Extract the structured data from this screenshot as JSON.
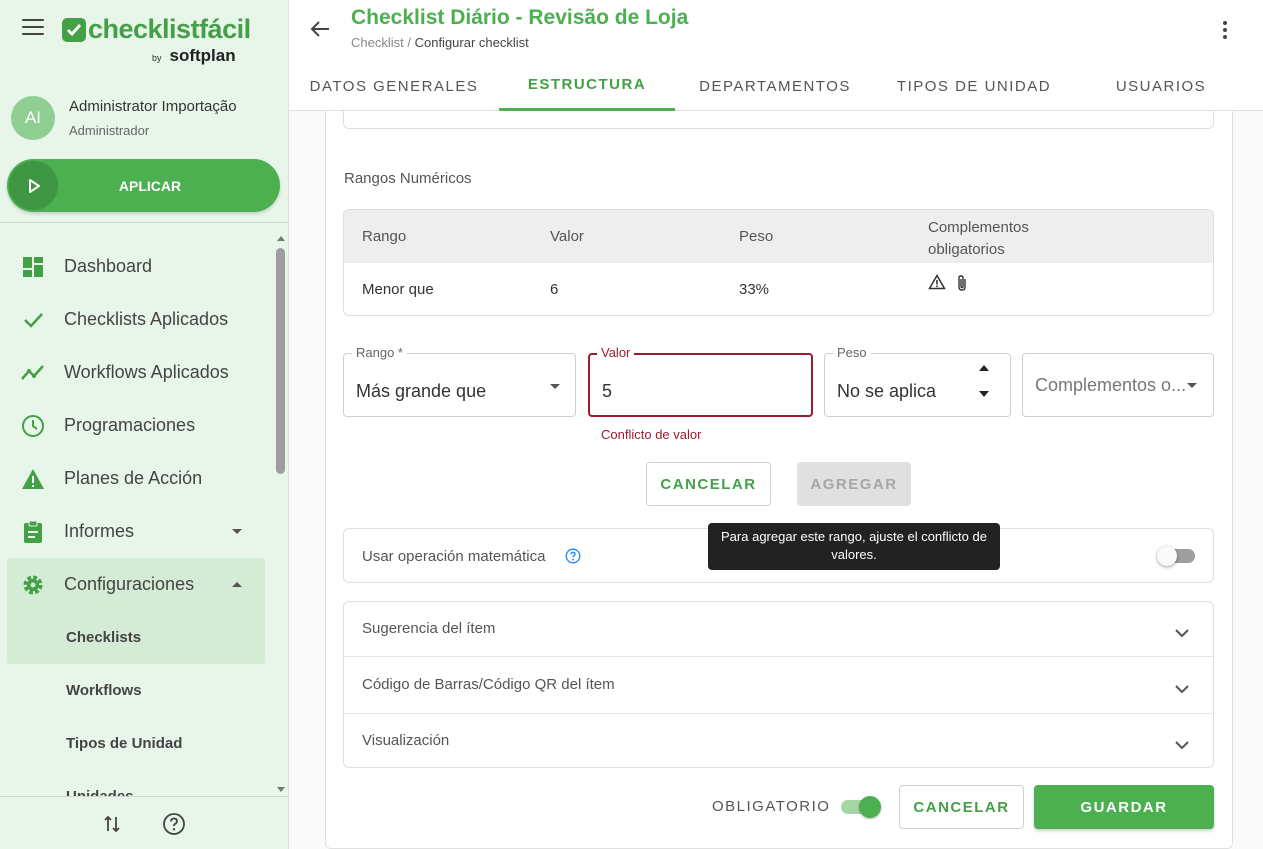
{
  "colors": {
    "brand": "#4caf50",
    "brand_dark": "#43a047",
    "sidebar_bg": "#e8f5e9",
    "error": "#9b1b30",
    "tooltip_bg": "#222222"
  },
  "brand": {
    "name": "checklistfácil",
    "by": "by",
    "company": "softplan"
  },
  "user": {
    "initials": "AI",
    "name": "Administrator Importação",
    "role": "Administrador"
  },
  "apply_button": {
    "label": "APLICAR",
    "icon": "play-icon"
  },
  "nav": {
    "items": [
      {
        "label": "Dashboard",
        "icon": "dashboard-icon"
      },
      {
        "label": "Checklists Aplicados",
        "icon": "check-icon"
      },
      {
        "label": "Workflows Aplicados",
        "icon": "trend-icon"
      },
      {
        "label": "Programaciones",
        "icon": "clock-icon"
      },
      {
        "label": "Planes de Acción",
        "icon": "warning-icon"
      },
      {
        "label": "Informes",
        "icon": "clipboard-icon"
      },
      {
        "label": "Configuraciones",
        "icon": "gear-icon"
      }
    ],
    "sub_items": [
      {
        "label": "Checklists"
      },
      {
        "label": "Workflows"
      },
      {
        "label": "Tipos de Unidad"
      },
      {
        "label": "Unidades"
      }
    ]
  },
  "header": {
    "title": "Checklist Diário - Revisão de Loja",
    "breadcrumb_root": "Checklist",
    "breadcrumb_sep": " / ",
    "breadcrumb_current": "Configurar checklist"
  },
  "tabs": [
    {
      "label": "DATOS GENERALES"
    },
    {
      "label": "ESTRUCTURA"
    },
    {
      "label": "DEPARTAMENTOS"
    },
    {
      "label": "TIPOS DE UNIDAD"
    },
    {
      "label": "USUARIOS"
    }
  ],
  "ranges": {
    "section_label": "Rangos Numéricos",
    "columns": [
      "Rango",
      "Valor",
      "Peso",
      "Complementos obligatorios"
    ],
    "rows": [
      {
        "rango": "Menor que",
        "valor": "6",
        "peso": "33%",
        "complementos": [
          "warning-icon",
          "attachment-icon"
        ]
      }
    ]
  },
  "form": {
    "rango": {
      "label": "Rango *",
      "value": "Más grande que"
    },
    "valor": {
      "label": "Valor",
      "value": "5",
      "error": "Conflicto de valor"
    },
    "peso": {
      "label": "Peso",
      "value": "No se aplica"
    },
    "complementos": {
      "placeholder": "Complementos o..."
    },
    "cancel_label": "CANCELAR",
    "add_label": "AGREGAR"
  },
  "tooltip": {
    "text": "Para agregar este rango, ajuste el conflicto de valores."
  },
  "math": {
    "label": "Usar operación matemática",
    "enabled": false
  },
  "accordion": [
    {
      "label": "Sugerencia del ítem"
    },
    {
      "label": "Código de Barras/Código QR del ítem"
    },
    {
      "label": "Visualización"
    }
  ],
  "footer": {
    "obligatorio_label": "OBLIGATORIO",
    "obligatorio_on": true,
    "cancel_label": "CANCELAR",
    "save_label": "GUARDAR"
  }
}
